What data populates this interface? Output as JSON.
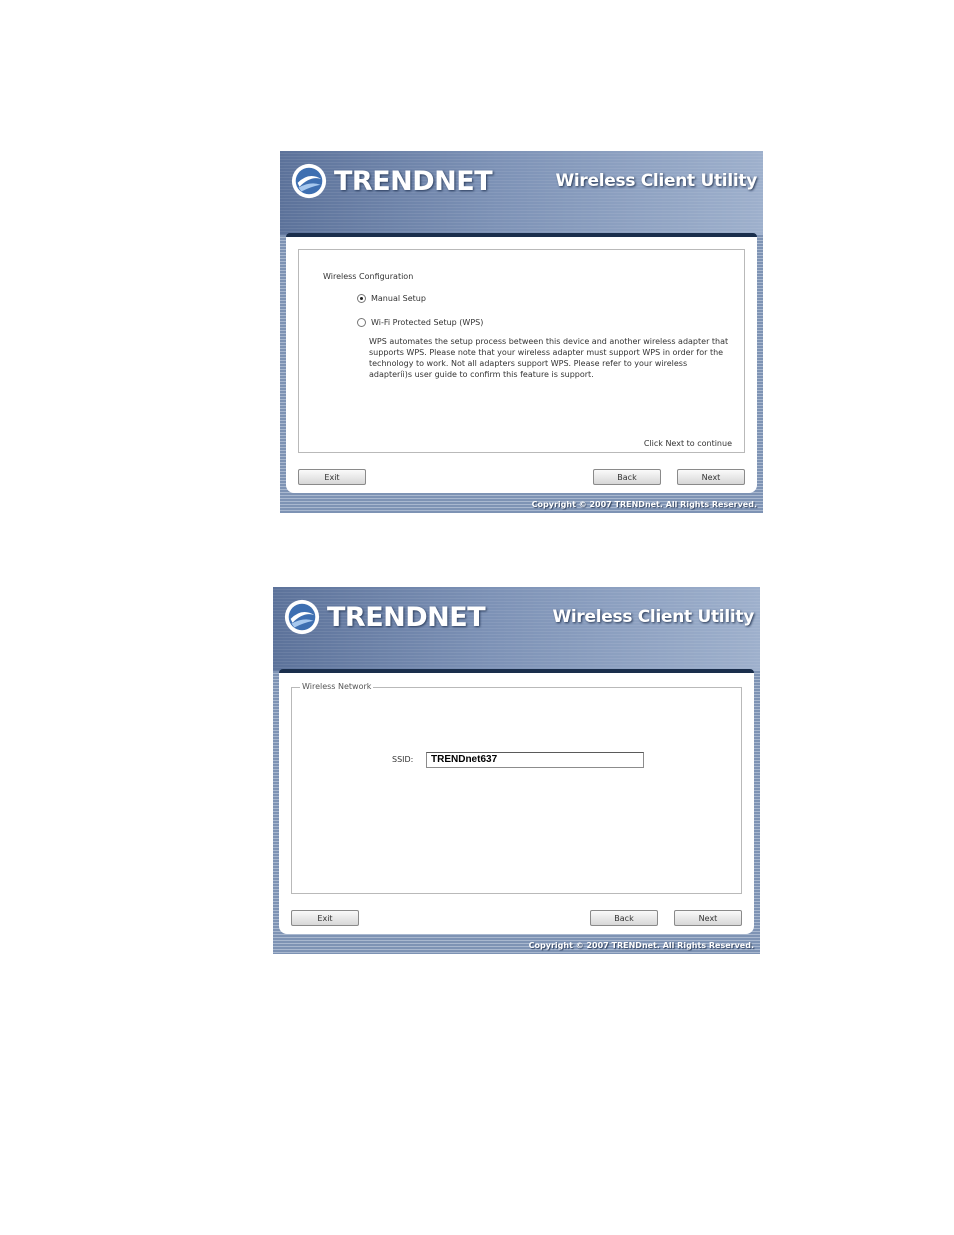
{
  "brand": {
    "logo_text": "TRENDNET",
    "app_title": "Wireless Client Utility"
  },
  "copyright": "Copyright © 2007 TRENDnet. All Rights Reserved.",
  "screen1": {
    "section_title": "Wireless Configuration",
    "options": [
      {
        "label": "Manual Setup",
        "selected": true
      },
      {
        "label": "Wi-Fi Protected Setup (WPS)",
        "selected": false
      }
    ],
    "description": "WPS automates the setup process between this device and another wireless adapter that supports WPS. Please note that your wireless adapter must support WPS in order for the technology to work. Not all adapters support WPS. Please refer to your wireless adapteríi)s user guide to confirm this feature is support.",
    "hint": "Click Next to continue",
    "buttons": {
      "exit": "Exit",
      "back": "Back",
      "next": "Next"
    }
  },
  "screen2": {
    "group_title": "Wireless Network",
    "ssid_label": "SSID:",
    "ssid_value": "TRENDnet637",
    "buttons": {
      "exit": "Exit",
      "back": "Back",
      "next": "Next"
    }
  }
}
